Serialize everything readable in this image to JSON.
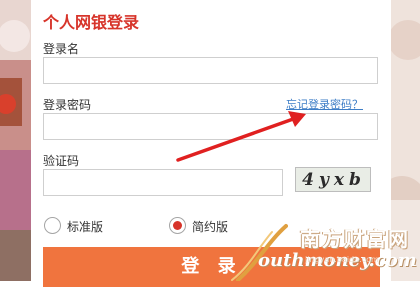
{
  "form": {
    "title": "个人网银登录",
    "username_label": "登录名",
    "username_value": "",
    "password_label": "登录密码",
    "password_value": "",
    "forgot_link": "忘记登录密码？",
    "captcha_label": "验证码",
    "captcha_value": "",
    "captcha_text": "4yxb",
    "version_standard": "标准版",
    "version_simple": "简约版",
    "selected_version": "简约版",
    "login_button": "登 录"
  },
  "watermark": {
    "chinese": "南方财富网",
    "english": "outhmoney.com",
    "small": "jingyan.baidu.com"
  },
  "colors": {
    "accent_red": "#d7342a",
    "button_orange": "#f0743e",
    "link_blue": "#3d7dc6",
    "arrow_red": "#e02020"
  }
}
